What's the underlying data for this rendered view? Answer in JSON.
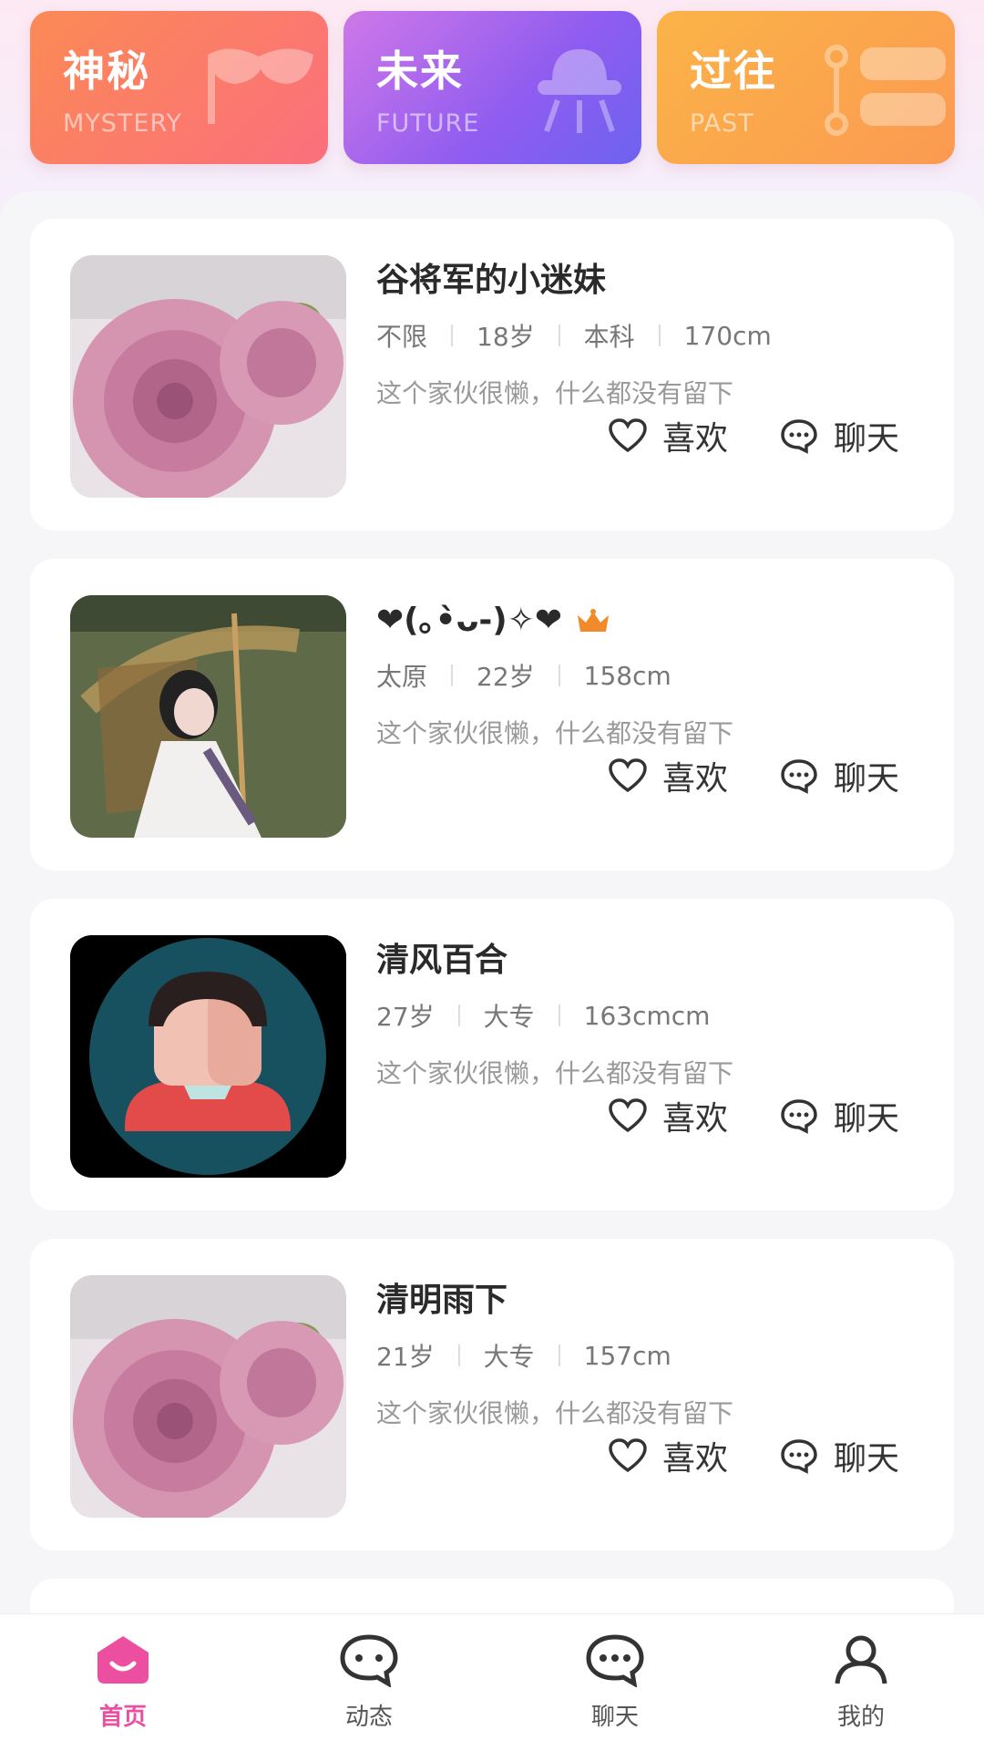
{
  "categories": [
    {
      "title": "神秘",
      "subtitle": "MYSTERY",
      "icon": "mask-icon"
    },
    {
      "title": "未来",
      "subtitle": "FUTURE",
      "icon": "ufo-icon"
    },
    {
      "title": "过往",
      "subtitle": "PAST",
      "icon": "path-icon"
    }
  ],
  "cards": [
    {
      "name": "谷将军的小迷妹",
      "meta": [
        "不限",
        "18岁",
        "本科",
        "170cm"
      ],
      "bio": "这个家伙很懒，什么都没有留下",
      "like": "喜欢",
      "chat": "聊天",
      "avatar": "rose-photo"
    },
    {
      "name": "❤(｡•̀ᴗ-)✧❤",
      "meta": [
        "太原",
        "22岁",
        "158cm"
      ],
      "bio": "这个家伙很懒，什么都没有留下",
      "like": "喜欢",
      "chat": "聊天",
      "avatar": "umbrella-photo",
      "badge": "crown-icon"
    },
    {
      "name": "清风百合",
      "meta": [
        "27岁",
        "大专",
        "163cmcm"
      ],
      "bio": "这个家伙很懒，什么都没有留下",
      "like": "喜欢",
      "chat": "聊天",
      "avatar": "default-avatar"
    },
    {
      "name": "清明雨下",
      "meta": [
        "21岁",
        "大专",
        "157cm"
      ],
      "bio": "这个家伙很懒，什么都没有留下",
      "like": "喜欢",
      "chat": "聊天",
      "avatar": "rose-photo"
    }
  ],
  "nav": [
    {
      "label": "首页",
      "icon": "home-icon",
      "active": true
    },
    {
      "label": "动态",
      "icon": "moments-icon"
    },
    {
      "label": "聊天",
      "icon": "chat-icon"
    },
    {
      "label": "我的",
      "icon": "profile-icon"
    }
  ],
  "colors": {
    "accent": "#ec4fa0",
    "mystery": "#fb7c66",
    "future": "#a366ee",
    "past": "#fba84c"
  }
}
